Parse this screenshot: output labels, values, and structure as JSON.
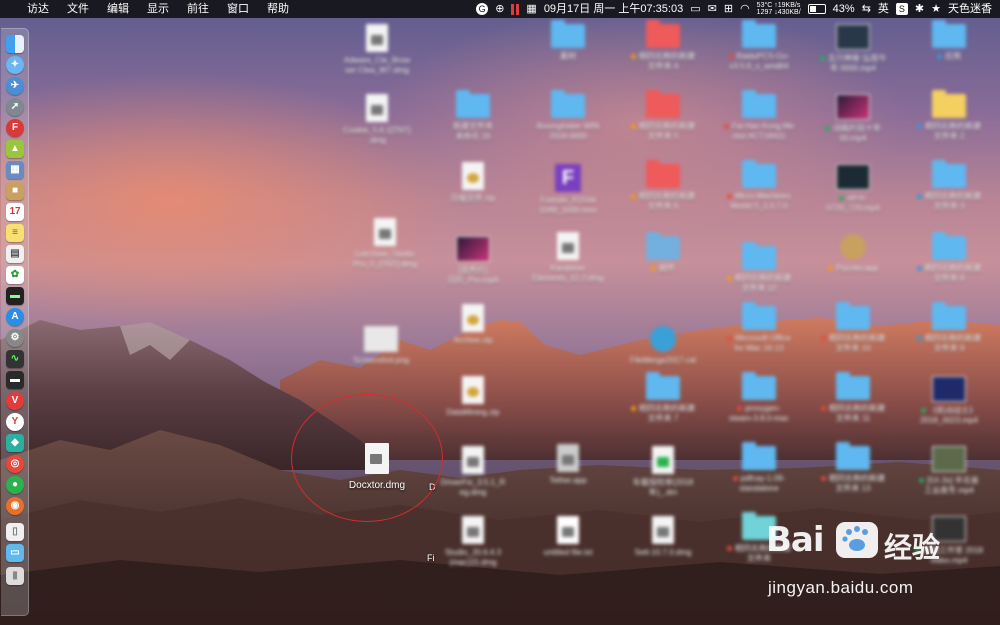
{
  "menubar": {
    "apple": "",
    "menus": [
      "访达",
      "文件",
      "编辑",
      "显示",
      "前往",
      "窗口",
      "帮助"
    ],
    "datetime": "09月17日 周一 上午07:35:03",
    "temp": "53°C",
    "net_up": "↑19KB/s",
    "net_line2": "1297 ↓430KB/",
    "battery_pct": "43%",
    "input_method": "英",
    "user": "天色迷香"
  },
  "dock": {
    "items": [
      "finder-icon",
      "safari-icon",
      "compass-icon",
      "launchpad-icon",
      "flashcard-icon",
      "android-icon",
      "preview-icon",
      "box-icon",
      "calendar-icon",
      "notes-icon",
      "photos-icon",
      "terminal-icon",
      "appstore-icon",
      "settings-icon",
      "activity-icon",
      "console-icon",
      "vivaldi-icon",
      "yandex-icon",
      "game-icon",
      "weibo-icon",
      "wechat-icon",
      "ubuntu-icon",
      "installer-icon",
      "folder-icon",
      "trash-icon"
    ]
  },
  "desktop": {
    "focus_file": "Docxtor.dmg",
    "partial_file": "D",
    "partial_file2": "Fi"
  },
  "watermark": {
    "logo": "Bai",
    "logo_suffix": "经验",
    "url": "jingyan.baidu.com"
  }
}
